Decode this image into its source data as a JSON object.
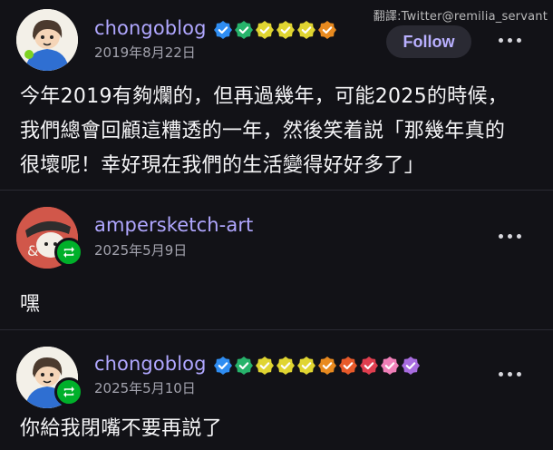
{
  "watermark": "翻譯:Twitter@remilia_servant",
  "posts": [
    {
      "username": "chongoblog",
      "date": "2019年8月22日",
      "follow_label": "Follow",
      "badge_colors": [
        "#2f8df2",
        "#27b36b",
        "#e0d531",
        "#e0d531",
        "#e0d531",
        "#e88a1f"
      ],
      "body_lines": [
        "今年2019有夠爛的，但再過幾年，可能2025的時候，",
        "我們總會回顧這糟透的一年，然後笑着説「那幾年真的",
        "很壞呢！幸好現在我們的生活變得好好多了」"
      ]
    },
    {
      "username": "ampersketch-art",
      "date": "2025年5月9日",
      "body": "嘿"
    },
    {
      "username": "chongoblog",
      "date": "2025年5月10日",
      "badge_colors": [
        "#2f8df2",
        "#27b36b",
        "#e0d531",
        "#e0d531",
        "#e0d531",
        "#e88a1f",
        "#e85a2a",
        "#e03e4f",
        "#f07fb8",
        "#a86ce0"
      ],
      "body": "你給我閉嘴不要再説了"
    }
  ],
  "icons": {
    "reblog": "reblog-icon",
    "more": "more-options-icon",
    "verified": "verified-badge-icon"
  }
}
